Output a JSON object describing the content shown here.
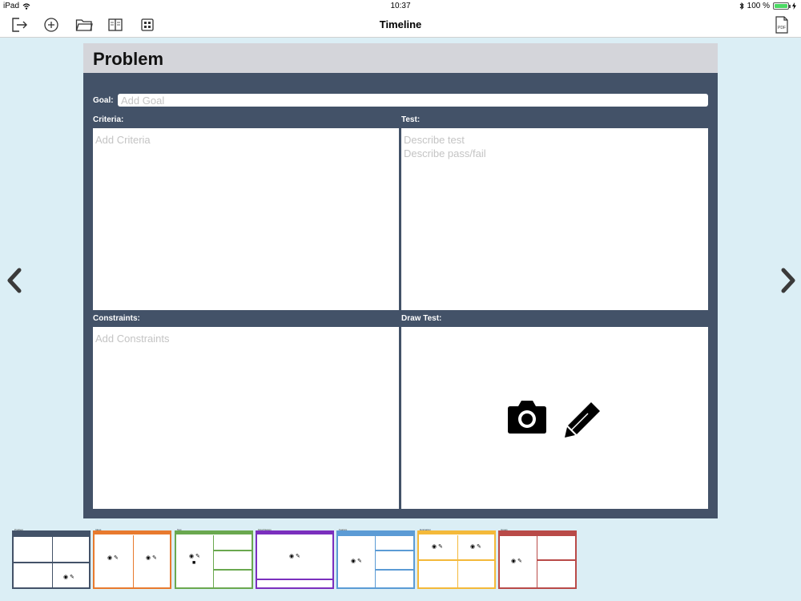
{
  "status_bar": {
    "device": "iPad",
    "time": "10:37",
    "battery": "100 %"
  },
  "navbar": {
    "title": "Timeline",
    "pdf_label": "PDF"
  },
  "card": {
    "title": "Problem",
    "goal_label": "Goal:",
    "goal_placeholder": "Add Goal",
    "criteria_label": "Criteria:",
    "criteria_placeholder": "Add Criteria",
    "test_label": "Test:",
    "test_placeholder": "Describe test\nDescribe pass/fail",
    "constraints_label": "Constraints:",
    "constraints_placeholder": "Add Constraints",
    "draw_test_label": "Draw Test:"
  },
  "colors": {
    "problem": "#435268",
    "ideas": "#e87a2e",
    "test": "#6aa84f",
    "final_design": "#7b2fbe",
    "feature": "#5b9bd5",
    "evaluation": "#f4b93a",
    "issues": "#b94a48"
  },
  "thumbnails": [
    {
      "name": "Problem",
      "color": "#435268"
    },
    {
      "name": "Ideas",
      "color": "#e87a2e"
    },
    {
      "name": "Test",
      "color": "#6aa84f"
    },
    {
      "name": "Final Design",
      "color": "#7b2fbe"
    },
    {
      "name": "Feature",
      "color": "#5b9bd5"
    },
    {
      "name": "Evaluation",
      "color": "#f4b93a"
    },
    {
      "name": "Issues",
      "color": "#b94a48"
    }
  ],
  "icons": {
    "exit": "exit-icon",
    "add": "add-icon",
    "folder": "folder-icon",
    "book": "book-icon",
    "grid": "grid-icon",
    "pdf": "pdf-icon",
    "camera": "camera-icon",
    "pencil": "pencil-icon",
    "prev": "chevron-left-icon",
    "next": "chevron-right-icon"
  }
}
